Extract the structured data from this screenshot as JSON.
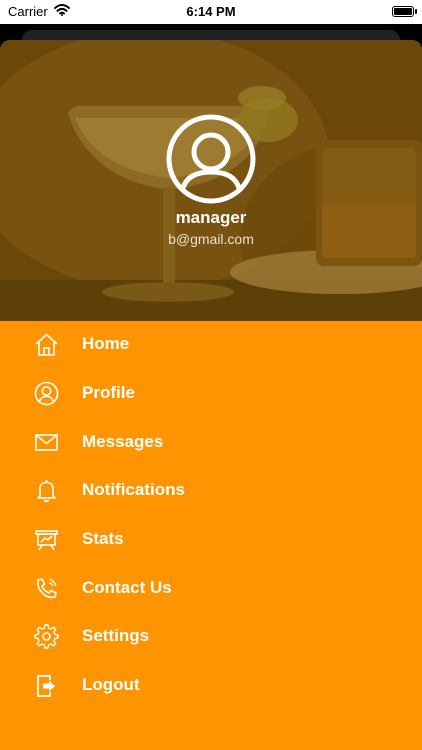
{
  "status_bar": {
    "carrier": "Carrier",
    "time": "6:14 PM"
  },
  "profile": {
    "name": "manager",
    "email": "b@gmail.com"
  },
  "menu": {
    "items": [
      {
        "label": "Home",
        "icon": "home-icon"
      },
      {
        "label": "Profile",
        "icon": "user-icon"
      },
      {
        "label": "Messages",
        "icon": "mail-icon"
      },
      {
        "label": "Notifications",
        "icon": "bell-icon"
      },
      {
        "label": "Stats",
        "icon": "chart-board-icon"
      },
      {
        "label": "Contact Us",
        "icon": "phone-icon"
      },
      {
        "label": "Settings",
        "icon": "gear-icon"
      },
      {
        "label": "Logout",
        "icon": "logout-icon"
      }
    ]
  },
  "colors": {
    "menu_background": "#fe9400",
    "text": "#ffffff"
  }
}
